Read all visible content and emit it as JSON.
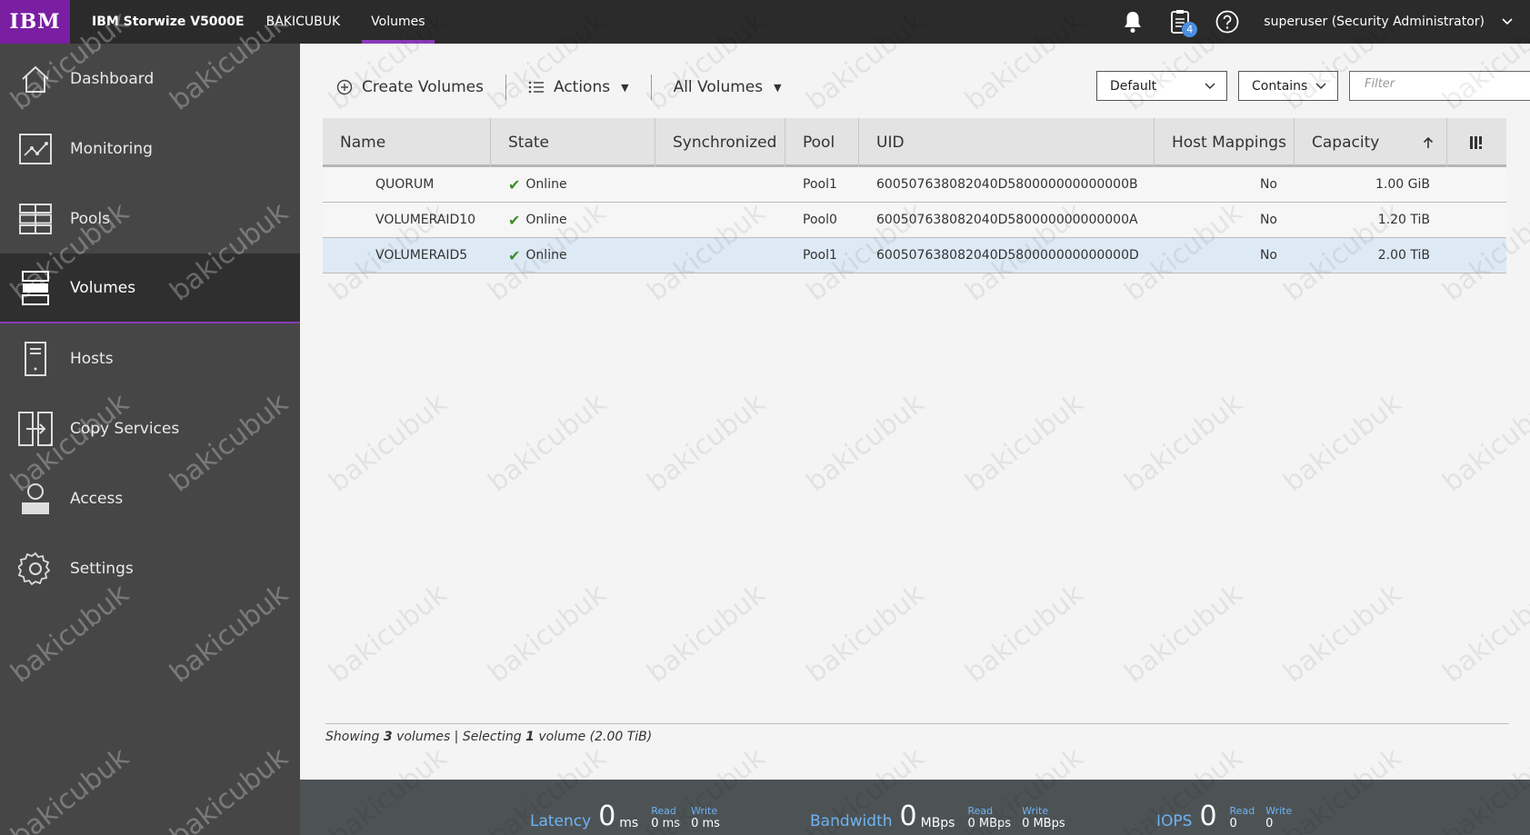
{
  "topbar": {
    "logo": "IBM",
    "product": "IBM Storwize V5000E",
    "system": "BAKICUBUK",
    "current_page": "Volumes",
    "tasks_badge": "4",
    "user": "superuser (Security Administrator)"
  },
  "sidebar": {
    "items": [
      {
        "label": "Dashboard",
        "icon": "home-icon"
      },
      {
        "label": "Monitoring",
        "icon": "monitoring-icon"
      },
      {
        "label": "Pools",
        "icon": "pools-icon"
      },
      {
        "label": "Volumes",
        "icon": "volumes-icon"
      },
      {
        "label": "Hosts",
        "icon": "hosts-icon"
      },
      {
        "label": "Copy Services",
        "icon": "copy-services-icon"
      },
      {
        "label": "Access",
        "icon": "access-icon"
      },
      {
        "label": "Settings",
        "icon": "settings-icon"
      }
    ],
    "active_index": 3
  },
  "toolbar": {
    "create_label": "Create Volumes",
    "actions_label": "Actions",
    "view_label": "All Volumes",
    "preset_select": "Default",
    "match_select": "Contains",
    "filter_placeholder": "Filter"
  },
  "table": {
    "columns": [
      "Name",
      "State",
      "Synchronized",
      "Pool",
      "UID",
      "Host Mappings",
      "Capacity"
    ],
    "sort_column": "Capacity",
    "sort_direction": "ascending",
    "rows": [
      {
        "name": "QUORUM",
        "state": "Online",
        "synchronized": "",
        "pool": "Pool1",
        "uid": "600507638082040D580000000000000B",
        "host_mappings": "No",
        "capacity": "1.00 GiB",
        "selected": false
      },
      {
        "name": "VOLUMERAID10",
        "state": "Online",
        "synchronized": "",
        "pool": "Pool0",
        "uid": "600507638082040D580000000000000A",
        "host_mappings": "No",
        "capacity": "1.20 TiB",
        "selected": false
      },
      {
        "name": "VOLUMERAID5",
        "state": "Online",
        "synchronized": "",
        "pool": "Pool1",
        "uid": "600507638082040D580000000000000D",
        "host_mappings": "No",
        "capacity": "2.00 TiB",
        "selected": true
      }
    ]
  },
  "footer": {
    "showing_prefix": "Showing ",
    "showing_count": "3",
    "showing_mid": " volumes | Selecting ",
    "selecting_count": "1",
    "selecting_suffix": " volume (2.00 TiB)"
  },
  "perf": {
    "latency": {
      "label": "Latency",
      "value": "0",
      "unit": "ms",
      "read_label": "Read",
      "read_value": "0 ms",
      "write_label": "Write",
      "write_value": "0 ms"
    },
    "bandwidth": {
      "label": "Bandwidth",
      "value": "0",
      "unit": "MBps",
      "read_label": "Read",
      "read_value": "0 MBps",
      "write_label": "Write",
      "write_value": "0 MBps"
    },
    "iops": {
      "label": "IOPS",
      "value": "0",
      "unit": "",
      "read_label": "Read",
      "read_value": "0",
      "write_label": "Write",
      "write_value": "0"
    }
  },
  "watermark": "bakicubuk",
  "colors": {
    "accent": "#8a3ab9",
    "online": "#3a8f27",
    "metric_label": "#6fb3f4",
    "selected_row": "#dde9f5"
  }
}
